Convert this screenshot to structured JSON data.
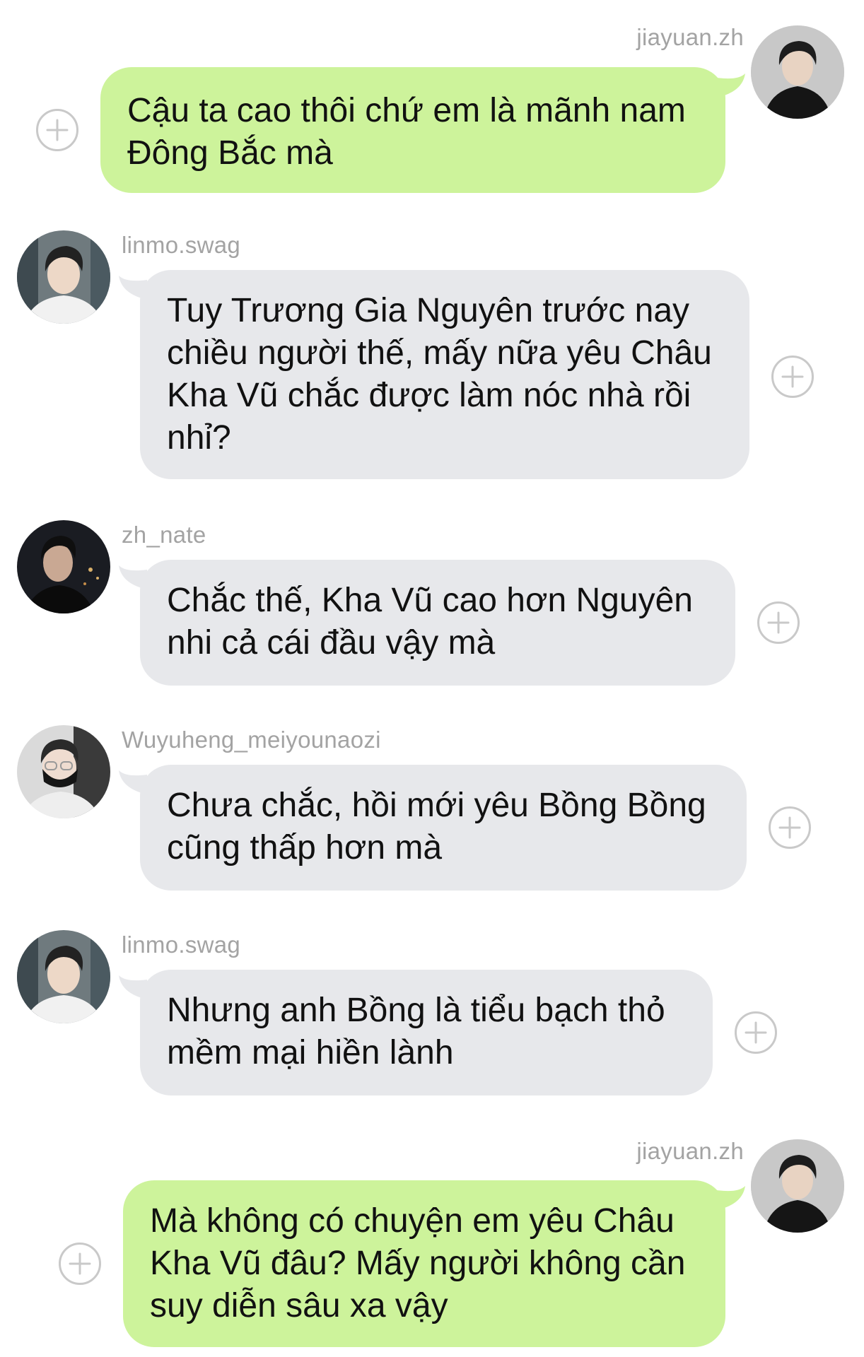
{
  "messages": [
    {
      "username": "jiayuan.zh",
      "side": "out",
      "avatar": "jiayuan-avatar",
      "text": "Cậu ta cao thôi chứ em là mãnh nam\nĐông Bắc mà"
    },
    {
      "username": "linmo.swag",
      "side": "in",
      "avatar": "linmo-avatar",
      "text": "Tuy Trương Gia Nguyên trước nay\nchiều người thế, mấy nữa yêu Châu\nKha Vũ chắc được làm nóc nhà rồi\nnhỉ?"
    },
    {
      "username": "zh_nate",
      "side": "in",
      "avatar": "nate-avatar",
      "text": "Chắc thế, Kha Vũ cao hơn Nguyên\nnhi cả cái đầu vậy mà"
    },
    {
      "username": "Wuyuheng_meiyounaozi",
      "side": "in",
      "avatar": "wuyuheng-avatar",
      "text": "Chưa chắc, hồi mới yêu Bồng Bồng\ncũng thấp hơn mà"
    },
    {
      "username": "linmo.swag",
      "side": "in",
      "avatar": "linmo-avatar",
      "text": "Nhưng anh Bồng là tiểu bạch thỏ\nmềm mại hiền lành"
    },
    {
      "username": "jiayuan.zh",
      "side": "out",
      "avatar": "jiayuan-avatar",
      "text": "Mà không có chuyện em yêu Châu\nKha Vũ đâu? Mấy người không cần\nsuy diễn sâu xa vậy"
    }
  ],
  "icons": {
    "add": "plus-circle-icon"
  },
  "colors": {
    "out_bubble": "#cdf39b",
    "in_bubble": "#e7e8eb",
    "username": "#a3a3a3",
    "plus": "#c9c9c9"
  }
}
